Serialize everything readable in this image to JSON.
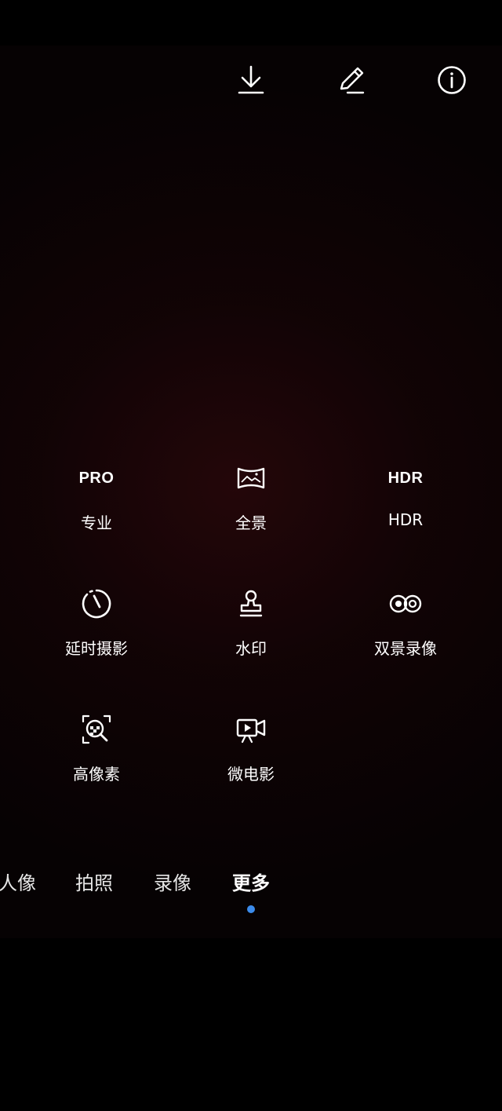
{
  "top_bar": {
    "icons": [
      "download-icon",
      "edit-icon",
      "info-icon"
    ]
  },
  "modes": [
    {
      "icon": "PRO",
      "label": "专业"
    },
    {
      "icon": "panorama-icon",
      "label": "全景"
    },
    {
      "icon": "HDR",
      "label": "HDR"
    },
    {
      "icon": "timelapse-icon",
      "label": "延时摄影"
    },
    {
      "icon": "stamp-icon",
      "label": "水印"
    },
    {
      "icon": "dual-view-icon",
      "label": "双景录像"
    },
    {
      "icon": "high-res-icon",
      "label": "高像素"
    },
    {
      "icon": "micro-movie-icon",
      "label": "微电影"
    }
  ],
  "mode_bar": {
    "tabs": [
      "人像",
      "拍照",
      "录像",
      "更多"
    ],
    "active": "更多"
  },
  "colors": {
    "accent": "#3b8beb",
    "icon": "#ffffff"
  }
}
